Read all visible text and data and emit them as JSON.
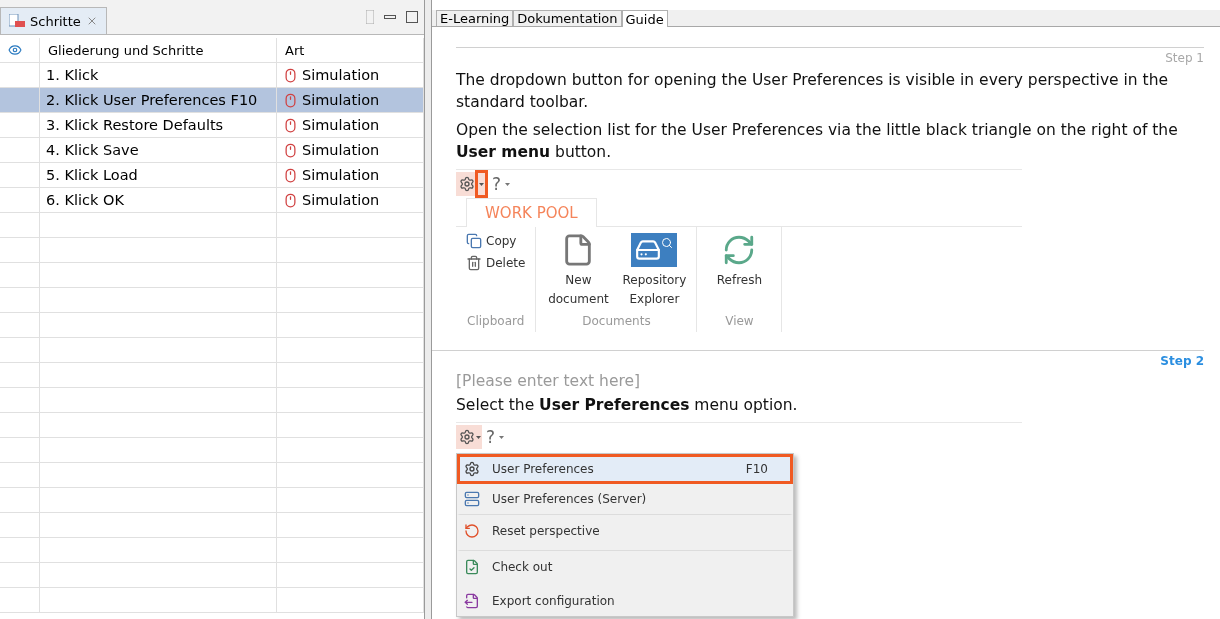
{
  "left_panel": {
    "tab": {
      "label": "Schritte"
    },
    "columns": [
      "Gliederung und Schritte",
      "Art"
    ],
    "rows": [
      {
        "name": "1. Klick",
        "type": "Simulation",
        "selected": false
      },
      {
        "name": "2. Klick User Preferences F10",
        "type": "Simulation",
        "selected": true
      },
      {
        "name": "3. Klick Restore Defaults",
        "type": "Simulation",
        "selected": false
      },
      {
        "name": "4. Klick Save",
        "type": "Simulation",
        "selected": false
      },
      {
        "name": "5. Klick Load",
        "type": "Simulation",
        "selected": false
      },
      {
        "name": "6. Klick OK",
        "type": "Simulation",
        "selected": false
      }
    ]
  },
  "right_panel": {
    "tabs": [
      {
        "label": "E-Learning",
        "selected": false
      },
      {
        "label": "Dokumentation",
        "selected": false
      },
      {
        "label": "Guide",
        "selected": true
      }
    ],
    "steps": [
      {
        "label": "Step 1",
        "active": false,
        "paragraphs": [
          "The dropdown button for opening the User Preferences is visible in every perspective in the standard toolbar.",
          "Open the selection list for the User Preferences via the little black triangle on the right of the **User menu** button."
        ],
        "screenshot": {
          "kind": "ribbon",
          "help": "?",
          "ribbon_tab": "WORK POOL",
          "groups": [
            {
              "label": "Clipboard",
              "kind": "small",
              "items": [
                {
                  "label": "Copy"
                },
                {
                  "label": "Delete"
                }
              ]
            },
            {
              "label": "Documents",
              "kind": "large",
              "items": [
                {
                  "label": "New document"
                },
                {
                  "label": "Repository Explorer"
                }
              ]
            },
            {
              "label": "View",
              "kind": "large",
              "items": [
                {
                  "label": "Refresh"
                }
              ]
            }
          ]
        }
      },
      {
        "label": "Step 2",
        "active": true,
        "placeholder": "[Please enter text here]",
        "paragraphs": [
          "Select the **User Preferences** menu option."
        ],
        "screenshot": {
          "kind": "menu",
          "help": "?",
          "items": [
            {
              "label": "User Preferences",
              "shortcut": "F10",
              "highlighted": true,
              "separator_before": false
            },
            {
              "label": "User Preferences (Server)",
              "highlighted": false,
              "separator_before": false
            },
            {
              "label": "Reset perspective",
              "highlighted": false,
              "separator_before": true
            },
            {
              "label": "Check out",
              "highlighted": false,
              "separator_before": true
            },
            {
              "label": "Export configuration",
              "highlighted": false,
              "separator_before": false
            }
          ]
        }
      }
    ]
  }
}
